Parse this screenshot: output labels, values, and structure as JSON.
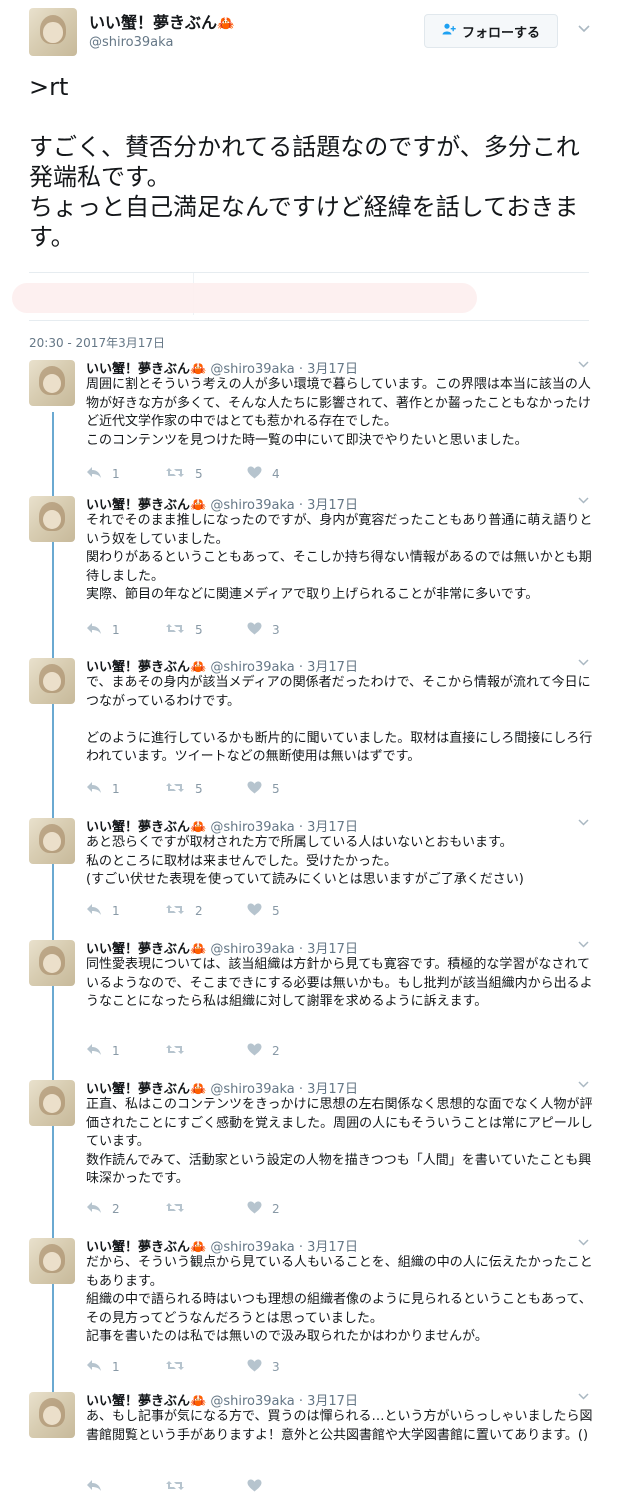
{
  "account": {
    "display_name": "いい蟹！夢きぶん",
    "name_emoji": "🦀",
    "handle": "@shiro39aka",
    "avatar": "avatar-image"
  },
  "follow_button": {
    "icon": "user-plus-icon",
    "label": "フォローする"
  },
  "main_tweet": {
    "text_line1": ">rt",
    "text_line2": "すごく、賛否分かれてる話題なのですが、多分これ発端私です。\nちょっと自己満足なんですけど経緯を話しておきます。",
    "timestamp": "20:30 - 2017年3月17日"
  },
  "colors": {
    "accent": "#1da1f2",
    "thread_line": "#6aa9d1",
    "muted": "#657786",
    "crab": "#d6243b"
  },
  "replies": [
    {
      "name": "いい蟹！夢きぶん🦀",
      "meta": "@shiro39aka · 3月17日",
      "text": "周囲に割とそういう考えの人が多い環境で暮らしています。この界隈は本当に該当の人物が好きな方が多くて、そんな人たちに影響されて、著作とか齧ったこともなかったけど近代文学作家の中ではとても惹かれる存在でした。\nこのコンテンツを見つけた時一覧の中にいて即決でやりたいと思いました。",
      "reply_count": "1",
      "retweet_count": "5",
      "like_count": "4"
    },
    {
      "name": "いい蟹！夢きぶん🦀",
      "meta": "@shiro39aka · 3月17日",
      "text": "それでそのまま推しになったのですが、身内が寛容だったこともあり普通に萌え語りという奴をしていました。\n関わりがあるということもあって、そこしか持ち得ない情報があるのでは無いかとも期待しました。\n実際、節目の年などに関連メディアで取り上げられることが非常に多いです。",
      "reply_count": "1",
      "retweet_count": "5",
      "like_count": "3"
    },
    {
      "name": "いい蟹！夢きぶん🦀",
      "meta": "@shiro39aka · 3月17日",
      "text": "で、まあその身内が該当メディアの関係者だったわけで、そこから情報が流れて今日につながっているわけです。\n\nどのように進行しているかも断片的に聞いていました。取材は直接にしろ間接にしろ行われています。ツイートなどの無断使用は無いはずです。",
      "reply_count": "1",
      "retweet_count": "5",
      "like_count": "5"
    },
    {
      "name": "いい蟹！夢きぶん🦀",
      "meta": "@shiro39aka · 3月17日",
      "text": "あと恐らくですが取材された方で所属している人はいないとおもいます。\n私のところに取材は来ませんでした。受けたかった。\n(すごい伏せた表現を使っていて読みにくいとは思いますがご了承ください)",
      "reply_count": "1",
      "retweet_count": "2",
      "like_count": "5"
    },
    {
      "name": "いい蟹！夢きぶん🦀",
      "meta": "@shiro39aka · 3月17日",
      "text": "同性愛表現については、該当組織は方針から見ても寛容です。積極的な学習がなされているようなので、そこまできにする必要は無いかも。もし批判が該当組織内から出るようなことになったら私は組織に対して謝罪を求めるように訴えます。",
      "reply_count": "1",
      "retweet_count": "",
      "like_count": "2"
    },
    {
      "name": "いい蟹！夢きぶん🦀",
      "meta": "@shiro39aka · 3月17日",
      "text": "正直、私はこのコンテンツをきっかけに思想の左右関係なく思想的な面でなく人物が評価されたことにすごく感動を覚えました。周囲の人にもそういうことは常にアピールしています。\n数作読んでみて、活動家という設定の人物を描きつつも「人間」を書いていたことも興味深かったです。",
      "reply_count": "2",
      "retweet_count": "",
      "like_count": "2"
    },
    {
      "name": "いい蟹！夢きぶん🦀",
      "meta": "@shiro39aka · 3月17日",
      "text": "だから、そういう観点から見ている人もいることを、組織の中の人に伝えたかったこともあります。\n組織の中で語られる時はいつも理想の組織者像のように見られるということもあって、その見方ってどうなんだろうとは思っていました。\n記事を書いたのは私では無いので汲み取られたかはわかりませんが。",
      "reply_count": "1",
      "retweet_count": "",
      "like_count": "3"
    },
    {
      "name": "いい蟹！夢きぶん🦀",
      "meta": "@shiro39aka · 3月17日",
      "text": "あ、もし記事が気になる方で、買うのは憚られる…という方がいらっしゃいましたら図書館閲覧という手がありますよ！意外と公共図書館や大学図書館に置いてあります。()",
      "reply_count": "",
      "retweet_count": "",
      "like_count": ""
    }
  ]
}
